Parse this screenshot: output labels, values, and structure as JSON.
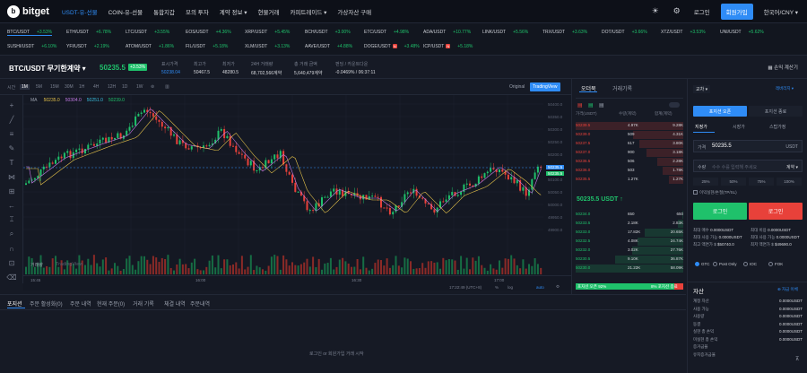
{
  "brand": {
    "name": "bitget"
  },
  "nav": {
    "items": [
      {
        "label": "USDT-유-선물",
        "active": true
      },
      {
        "label": "COIN-유-선물"
      },
      {
        "label": "통합지갑",
        "hot": "HOT"
      },
      {
        "label": "모의 투자"
      },
      {
        "label": "계약 정보 ▾"
      },
      {
        "label": "현물거래"
      },
      {
        "label": "카피트레이드 ▾"
      },
      {
        "label": "가상자산 구매"
      }
    ],
    "login": "로그인",
    "signup": "회원가입",
    "lang": "한국어/CNY ▾"
  },
  "ticker": {
    "row1": [
      {
        "sym": "BTC/USDT",
        "chg": "+3.53%"
      },
      {
        "sym": "ETH/USDT",
        "chg": "+6.78%"
      },
      {
        "sym": "LTC/USDT",
        "chg": "+3.55%"
      },
      {
        "sym": "EOS/USDT",
        "chg": "+4.36%"
      },
      {
        "sym": "XRP/USDT",
        "chg": "+5.45%"
      },
      {
        "sym": "BCH/USDT",
        "chg": "+3.00%"
      },
      {
        "sym": "ETC/USDT",
        "chg": "+4.98%"
      },
      {
        "sym": "ADA/USDT",
        "chg": "+10.77%"
      },
      {
        "sym": "LINK/USDT",
        "chg": "+5.56%"
      },
      {
        "sym": "TRX/USDT",
        "chg": "+3.63%"
      },
      {
        "sym": "DOT/USDT",
        "chg": "+3.66%"
      },
      {
        "sym": "XTZ/USDT",
        "chg": "+3.53%"
      },
      {
        "sym": "UNI/USDT",
        "chg": "+5.62%"
      }
    ],
    "row2": [
      {
        "sym": "SUSHI/USDT",
        "chg": "+6.10%"
      },
      {
        "sym": "YFI/USDT",
        "chg": "+2.19%"
      },
      {
        "sym": "ATOM/USDT",
        "chg": "+1.86%"
      },
      {
        "sym": "FIL/USDT",
        "chg": "+5.18%"
      },
      {
        "sym": "XLM/USDT",
        "chg": "+3.13%"
      },
      {
        "sym": "AAVE/USDT",
        "chg": "+4.88%"
      },
      {
        "sym": "DOGE/USDT",
        "chg": "+3.48%",
        "badge": "N"
      },
      {
        "sym": "ICP/USDT",
        "chg": "+5.18%",
        "badge": "N"
      }
    ]
  },
  "header": {
    "pair": "BTC/USDT 무기한계약 ▾",
    "price": "50235.5",
    "pct": "+3.53%",
    "stats": [
      {
        "label": "표시가격",
        "value": "50238.04",
        "color": "#2f8cf6"
      },
      {
        "label": "최고가",
        "value": "50467.5"
      },
      {
        "label": "최저가",
        "value": "48280.5"
      },
      {
        "label": "24H 거래량",
        "value": "68,702,566계약"
      },
      {
        "label": "총 거래 금액",
        "value": "5,640,479계약"
      },
      {
        "label": "펀딩 / 카운트다운",
        "value": "-0.0469% / 06:37:11"
      }
    ],
    "calc": "손익 계산기"
  },
  "toolbar": {
    "timeframes": [
      "시간",
      "1M",
      "5M",
      "15M",
      "30M",
      "1H",
      "4H",
      "12H",
      "1D",
      "1W"
    ],
    "active_tf": "1M",
    "original": "Original",
    "tradingview": "TradingView"
  },
  "chart_overlay": {
    "ma": "MA",
    "ma_values": [
      "50235.0",
      "50304.0",
      "50251.0",
      "50239.0"
    ],
    "vol_label": "거래량",
    "watermark": "TradingView",
    "axis": [
      "50400.0",
      "50350.0",
      "50300.0",
      "50250.0",
      "50200.0",
      "50150.0",
      "50100.0",
      "50050.0",
      "50000.0",
      "49950.0",
      "49900.0"
    ],
    "price_tags": [
      {
        "value": "50235.5",
        "color": "#2f8cf6"
      },
      {
        "value": "50235.5",
        "color": "#1fc16b"
      }
    ],
    "times": [
      "15:45",
      "16:00",
      "16:30",
      "17:00"
    ],
    "bottom_info": [
      "17:22:49 (UTC+8)",
      "%",
      "log",
      "auto"
    ]
  },
  "orderbook": {
    "tab_active": "오더북",
    "tab2": "거래기록",
    "headers": [
      "가격(USDT)",
      "수량(계약)",
      "합계(계약)"
    ],
    "asks": [
      {
        "p": "50239.5",
        "q": "4.97K",
        "t": "9.28K"
      },
      {
        "p": "50239.0",
        "q": "509",
        "t": "4.31K"
      },
      {
        "p": "50237.5",
        "q": "617",
        "t": "3.80K"
      },
      {
        "p": "50237.0",
        "q": "900",
        "t": "3.18K"
      },
      {
        "p": "50236.5",
        "q": "506",
        "t": "2.28K"
      },
      {
        "p": "50236.0",
        "q": "503",
        "t": "1.78K"
      },
      {
        "p": "50235.5",
        "q": "1.27K",
        "t": "1.27K"
      }
    ],
    "mid": "50235.5 USDT ↑",
    "bids": [
      {
        "p": "50234.0",
        "q": "650",
        "t": "650"
      },
      {
        "p": "50233.5",
        "q": "2.18K",
        "t": "2.83K"
      },
      {
        "p": "50233.0",
        "q": "17.82K",
        "t": "20.65K"
      },
      {
        "p": "50232.5",
        "q": "4.08K",
        "t": "24.74K"
      },
      {
        "p": "50232.0",
        "q": "3.02K",
        "t": "27.76K"
      },
      {
        "p": "50230.5",
        "q": "9.10K",
        "t": "36.87K"
      },
      {
        "p": "50230.0",
        "q": "21.22K",
        "t": "58.09K"
      }
    ],
    "ratio": {
      "buy": "92%",
      "sell": "8%",
      "buy_label": "포지션 오픈",
      "sell_label": "포지션 종료"
    }
  },
  "trade": {
    "mode": "교차 ▾",
    "leverage": "레버리지 ▾",
    "open_tab": "포지션 오픈",
    "close_tab": "포지션 종료",
    "subtabs": [
      "지정가",
      "시장가",
      "스탑가정"
    ],
    "price_label": "가격",
    "price_value": "50235.5",
    "price_unit": "USDT",
    "qty_label": "수량",
    "qty_placeholder": "수수 수를 입력해 주세요",
    "qty_unit": "계약 ▾",
    "pcts": [
      "25%",
      "50%",
      "75%",
      "100%"
    ],
    "check": "이익실현/손절(TP/SL)",
    "buy_btn": "로그인",
    "sell_btn": "로그인",
    "info_left": [
      {
        "l": "최대 매수",
        "v": "0.0000USDT"
      },
      {
        "l": "최대 사용 가능",
        "v": "0.0000USDT"
      },
      {
        "l": "최고 액면가 $",
        "v": "$50740.0"
      }
    ],
    "info_right": [
      {
        "l": "최대 비용",
        "v": "0.0000USDT"
      },
      {
        "l": "최대 사용 가능",
        "v": "0.0000USDT"
      },
      {
        "l": "최저 액면가 $",
        "v": "$49690.0"
      }
    ],
    "radios": [
      "GTC",
      "Post Only",
      "IOC",
      "FOK"
    ]
  },
  "bottom": {
    "tabs": [
      "포지션",
      "주문 활성화(0)",
      "주문 내역",
      "현재 주문(0)",
      "거래 기록",
      "체결 내역",
      "주문내역"
    ],
    "empty": "로그인 or 회원가입 거래 시작"
  },
  "assets": {
    "title": "자산",
    "transfer": "자금 이체",
    "rows": [
      {
        "l": "계정 자산",
        "v": "0.0000USDT"
      },
      {
        "l": "사용 가능",
        "v": "0.0000USDT"
      },
      {
        "l": "사용량",
        "v": "0.0000USDT"
      },
      {
        "l": "동결",
        "v": "0.0000USDT"
      },
      {
        "l": "실현 총 손익",
        "v": "0.0000USDT"
      },
      {
        "l": "미실현 총 손익",
        "v": "0.0000USDT"
      },
      {
        "l": "증거금율",
        "v": ""
      },
      {
        "l": "유지증거금율",
        "v": ""
      }
    ]
  }
}
